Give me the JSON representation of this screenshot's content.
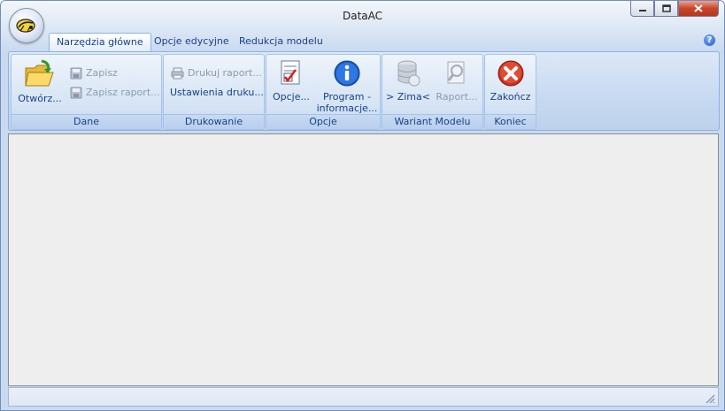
{
  "window": {
    "title": "DataAC"
  },
  "tabs": [
    {
      "label": "Narzędzia główne",
      "active": true
    },
    {
      "label": "Opcje edycyjne",
      "active": false
    },
    {
      "label": "Redukcja modelu",
      "active": false
    }
  ],
  "help_label": "?",
  "groups": {
    "dane": {
      "label": "Dane",
      "open_label": "Otwórz...",
      "save_label": "Zapisz",
      "save_report_label": "Zapisz raport..."
    },
    "drukowanie": {
      "label": "Drukowanie",
      "print_report_label": "Drukuj raport...",
      "print_settings_label": "Ustawienia druku..."
    },
    "opcje": {
      "label": "Opcje",
      "options_label": "Opcje...",
      "program_info_line1": "Program -",
      "program_info_line2": "informacje..."
    },
    "wariant": {
      "label": "Wariant Modelu",
      "zima_label": "> Zima<",
      "raport_label": "Raport..."
    },
    "koniec": {
      "label": "Koniec",
      "exit_label": "Zakończ"
    }
  },
  "colors": {
    "ribbon_text": "#15428b",
    "disabled_text": "#8d9bb0",
    "close_red": "#c9462c"
  }
}
